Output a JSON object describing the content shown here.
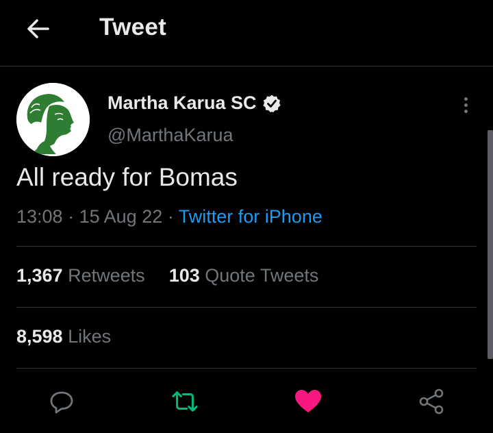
{
  "header": {
    "title": "Tweet",
    "back_icon": "arrow-left-icon"
  },
  "author": {
    "name": "Martha Karua SC",
    "handle": "@MarthaKarua",
    "verified": true,
    "avatar_color": "#2e7d32"
  },
  "tweet": {
    "text": "All ready for Bomas",
    "time": "13:08",
    "date": "15 Aug 22",
    "separator": "·",
    "source": "Twitter for iPhone"
  },
  "stats": {
    "retweets_count": "1,367",
    "retweets_label": "Retweets",
    "quotes_count": "103",
    "quotes_label": "Quote Tweets",
    "likes_count": "8,598",
    "likes_label": "Likes"
  },
  "actions": [
    {
      "name": "reply",
      "icon": "reply-icon",
      "color": "#71767b"
    },
    {
      "name": "retweet",
      "icon": "retweet-icon",
      "color": "#00ba7c"
    },
    {
      "name": "like",
      "icon": "heart-icon",
      "color": "#f91880"
    },
    {
      "name": "share",
      "icon": "share-icon",
      "color": "#71767b"
    }
  ],
  "colors": {
    "background": "#000000",
    "text": "#e7e9ea",
    "muted": "#71767b",
    "link": "#1d9bf0",
    "divider": "#2f3336"
  }
}
